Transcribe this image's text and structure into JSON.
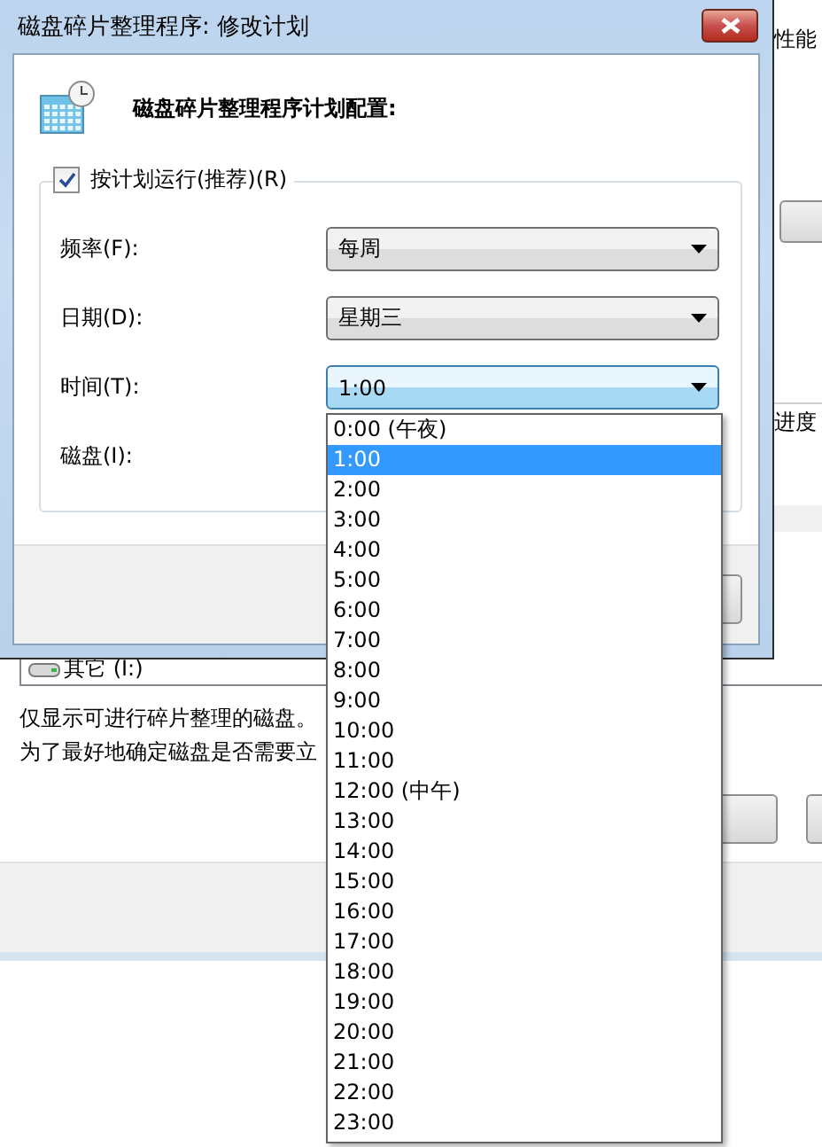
{
  "background_window": {
    "header_text": "性能",
    "progress_label": "进度",
    "disk_list": [
      {
        "name": "其它 (I:)"
      }
    ],
    "note_lines": [
      "仅显示可进行碎片整理的磁盘。",
      "为了最好地确定磁盘是否需要立"
    ]
  },
  "dialog": {
    "title": "磁盘碎片整理程序: 修改计划",
    "heading": "磁盘碎片整理程序计划配置:",
    "run_on_schedule": {
      "label": "按计划运行(推荐)(R)",
      "checked": true
    },
    "fields": [
      {
        "label": "频率(F):",
        "value": "每周",
        "open": false
      },
      {
        "label": "日期(D):",
        "value": "星期三",
        "open": false
      },
      {
        "label": "时间(T):",
        "value": "1:00",
        "open": true
      }
    ],
    "disk_label": "磁盘(I):"
  },
  "dropdown": {
    "options": [
      {
        "label": "0:00 (午夜)",
        "selected": false
      },
      {
        "label": "1:00",
        "selected": true
      },
      {
        "label": "2:00",
        "selected": false
      },
      {
        "label": "3:00",
        "selected": false
      },
      {
        "label": "4:00",
        "selected": false
      },
      {
        "label": "5:00",
        "selected": false
      },
      {
        "label": "6:00",
        "selected": false
      },
      {
        "label": "7:00",
        "selected": false
      },
      {
        "label": "8:00",
        "selected": false
      },
      {
        "label": "9:00",
        "selected": false
      },
      {
        "label": "10:00",
        "selected": false
      },
      {
        "label": "11:00",
        "selected": false
      },
      {
        "label": "12:00 (中午)",
        "selected": false
      },
      {
        "label": "13:00",
        "selected": false
      },
      {
        "label": "14:00",
        "selected": false
      },
      {
        "label": "15:00",
        "selected": false
      },
      {
        "label": "16:00",
        "selected": false
      },
      {
        "label": "17:00",
        "selected": false
      },
      {
        "label": "18:00",
        "selected": false
      },
      {
        "label": "19:00",
        "selected": false
      },
      {
        "label": "20:00",
        "selected": false
      },
      {
        "label": "21:00",
        "selected": false
      },
      {
        "label": "22:00",
        "selected": false
      },
      {
        "label": "23:00",
        "selected": false
      }
    ]
  }
}
